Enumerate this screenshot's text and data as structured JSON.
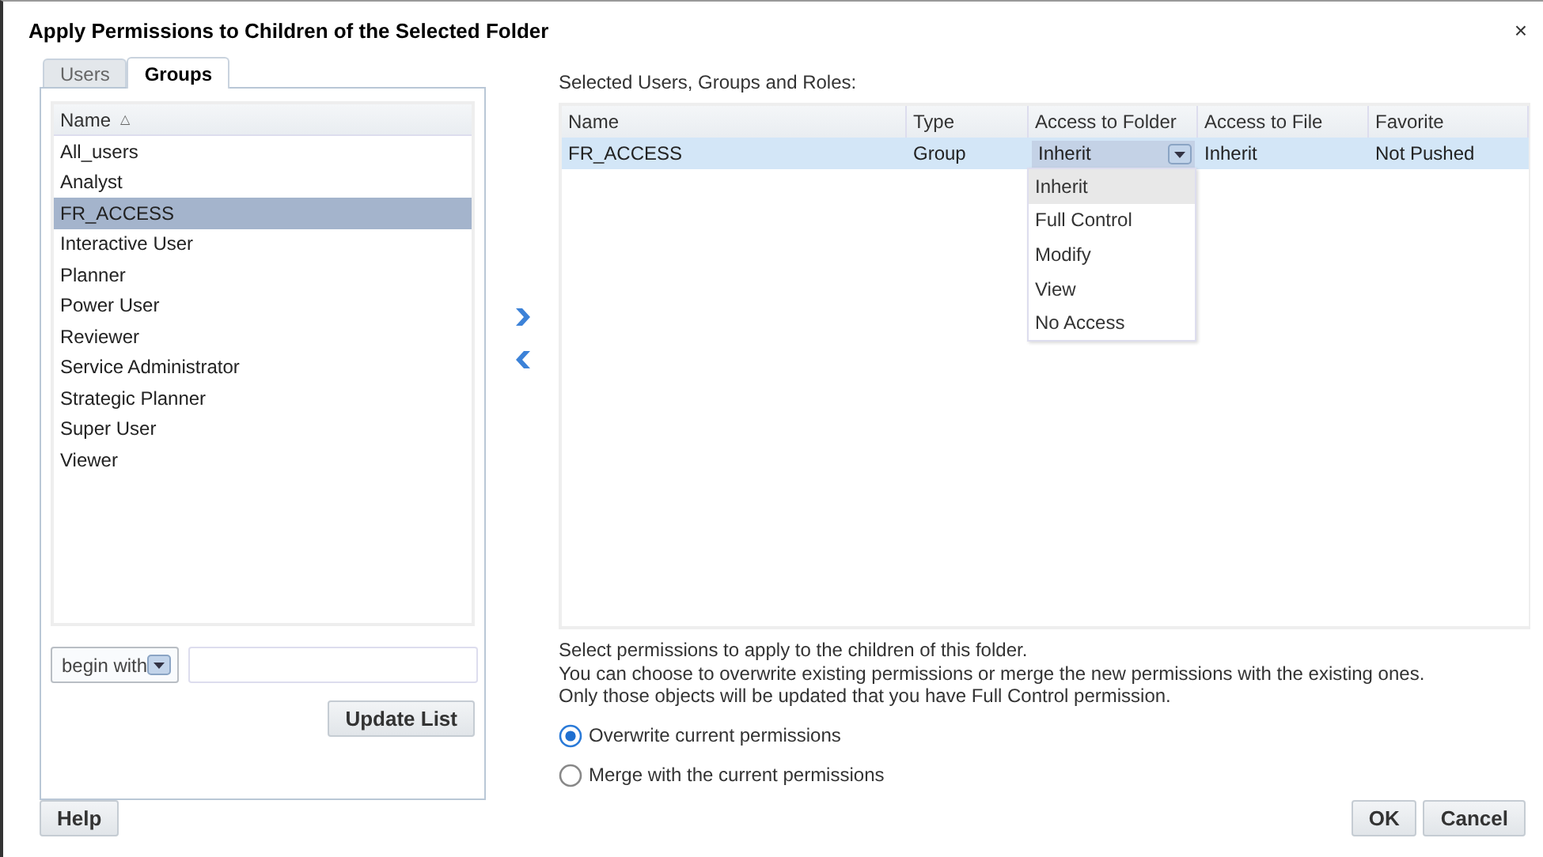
{
  "window": {
    "title": "Apply Permissions to Children of the Selected Folder",
    "close": "×"
  },
  "tabs": [
    {
      "label": "Users",
      "selected": false
    },
    {
      "label": "Groups",
      "selected": true
    }
  ],
  "group_list": {
    "column": "Name",
    "sort_mark": "△",
    "items": [
      {
        "label": "All_users",
        "selected": false
      },
      {
        "label": "Analyst",
        "selected": false
      },
      {
        "label": "FR_ACCESS",
        "selected": true
      },
      {
        "label": "Interactive User",
        "selected": false
      },
      {
        "label": "Planner",
        "selected": false
      },
      {
        "label": "Power User",
        "selected": false
      },
      {
        "label": "Reviewer",
        "selected": false
      },
      {
        "label": "Service Administrator",
        "selected": false
      },
      {
        "label": "Strategic Planner",
        "selected": false
      },
      {
        "label": "Super User",
        "selected": false
      },
      {
        "label": "Viewer",
        "selected": false
      }
    ]
  },
  "filter": {
    "mode": "begin with"
  },
  "update_button": "Update List",
  "selected_label": "Selected Users, Groups and Roles:",
  "table": {
    "columns": [
      "Name",
      "Type",
      "Access to Folder",
      "Access to File",
      "Favorite"
    ],
    "rows": [
      {
        "name": "FR_ACCESS",
        "type": "Group",
        "access_to_folder": "Inherit",
        "access_to_file": "Inherit",
        "favorite": "Not Pushed",
        "selected": true
      }
    ]
  },
  "access_menu": [
    {
      "label": "Inherit",
      "selected": true
    },
    {
      "label": "Full Control",
      "selected": false
    },
    {
      "label": "Modify",
      "selected": false
    },
    {
      "label": "View",
      "selected": false
    },
    {
      "label": "No Access",
      "selected": false
    }
  ],
  "description": [
    "Select permissions to apply to the children of this folder.",
    "You can choose to overwrite existing permissions or merge the new permissions with the existing ones.",
    "Only those objects will be updated that you have Full Control permission."
  ],
  "options": [
    {
      "label": "Overwrite current permissions",
      "selected": true
    },
    {
      "label": "Merge with the current permissions",
      "selected": false
    }
  ],
  "buttons": {
    "help": "Help",
    "ok": "OK",
    "cancel": "Cancel"
  }
}
